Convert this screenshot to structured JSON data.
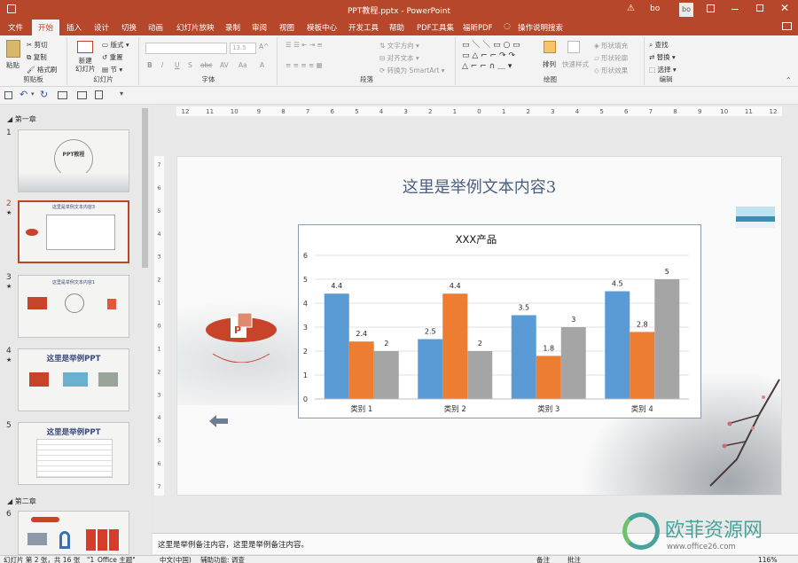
{
  "window": {
    "title": "PPT教程.pptx  -  PowerPoint",
    "warning_icon": "warning-icon",
    "user": "bo",
    "avatar": "bo"
  },
  "tabs": [
    "文件",
    "开始",
    "插入",
    "设计",
    "切换",
    "动画",
    "幻灯片放映",
    "录制",
    "审阅",
    "视图",
    "模板中心",
    "开发工具",
    "帮助",
    "PDF工具集",
    "福昕PDF",
    "操作说明搜索"
  ],
  "active_tab": "开始",
  "ribbon": {
    "clipboard": {
      "paste": "粘贴",
      "cut": "剪切",
      "copy": "复制",
      "format_painter": "格式刷",
      "label": "剪贴板"
    },
    "slides": {
      "new_slide": "新建\n幻灯片",
      "layout": "版式",
      "reset": "重置",
      "section": "节",
      "label": "幻灯片"
    },
    "font": {
      "font_size": "13.5",
      "label": "字体",
      "buttons": [
        "B",
        "I",
        "U",
        "S",
        "abc",
        "AV",
        "Aa",
        "A"
      ]
    },
    "paragraph": {
      "text_direction": "文字方向",
      "align_text": "对齐文本",
      "convert_smartart": "转换为 SmartArt",
      "label": "段落"
    },
    "drawing": {
      "arrange": "排列",
      "quick_styles": "快速样式",
      "shape_fill": "形状填充",
      "shape_outline": "形状轮廓",
      "shape_effects": "形状效果",
      "label": "绘图"
    },
    "editing": {
      "find": "查找",
      "replace": "替换",
      "select": "选择",
      "label": "编辑"
    }
  },
  "thumbnails": {
    "sections": [
      "第一章",
      "第二章"
    ],
    "slides": [
      {
        "num": "1",
        "title": "PPT教程"
      },
      {
        "num": "2",
        "star": "★",
        "title": "这里是举例文本内容3"
      },
      {
        "num": "3",
        "star": "★",
        "title": "这里是举例文本内容1"
      },
      {
        "num": "4",
        "star": "★",
        "title": "这里是举例PPT"
      },
      {
        "num": "5",
        "title": "这里是举例PPT"
      },
      {
        "num": "6",
        "title": ""
      }
    ]
  },
  "ruler": {
    "h_ticks": [
      "12",
      "11",
      "10",
      "9",
      "8",
      "7",
      "6",
      "5",
      "4",
      "3",
      "2",
      "1",
      "0",
      "1",
      "2",
      "3",
      "4",
      "5",
      "6",
      "7",
      "8",
      "9",
      "10",
      "11",
      "12"
    ],
    "v_ticks": [
      "7",
      "6",
      "5",
      "4",
      "3",
      "2",
      "1",
      "0",
      "1",
      "2",
      "3",
      "4",
      "5",
      "6",
      "7"
    ]
  },
  "slide": {
    "title": "这里是举例文本内容3"
  },
  "chart_data": {
    "type": "bar",
    "title": "XXX产品",
    "categories": [
      "类别 1",
      "类别 2",
      "类别 3",
      "类别 4"
    ],
    "series": [
      {
        "values": [
          4.4,
          2.5,
          3.5,
          4.5
        ],
        "color": "#5b9bd5"
      },
      {
        "values": [
          2.4,
          4.4,
          1.8,
          2.8
        ],
        "color": "#ed7d31"
      },
      {
        "values": [
          2,
          2,
          3,
          5
        ],
        "color": "#a5a5a5"
      }
    ],
    "ylim": [
      0,
      6
    ],
    "yticks": [
      "0",
      "1",
      "2",
      "3",
      "4",
      "5",
      "6"
    ],
    "grid": true
  },
  "notes": "这里是举例备注内容，这里是举例备注内容。",
  "status": {
    "slide_info": "幻灯片 第 2 张，共 16 张",
    "theme": "\"1_Office 主题\"",
    "language": "中文(中国)",
    "accessibility": "辅助功能: 调查",
    "notes_btn": "备注",
    "comments_btn": "批注",
    "zoom": "116%"
  },
  "watermark": {
    "name": "欧菲资源网",
    "url": "www.office26.com"
  }
}
